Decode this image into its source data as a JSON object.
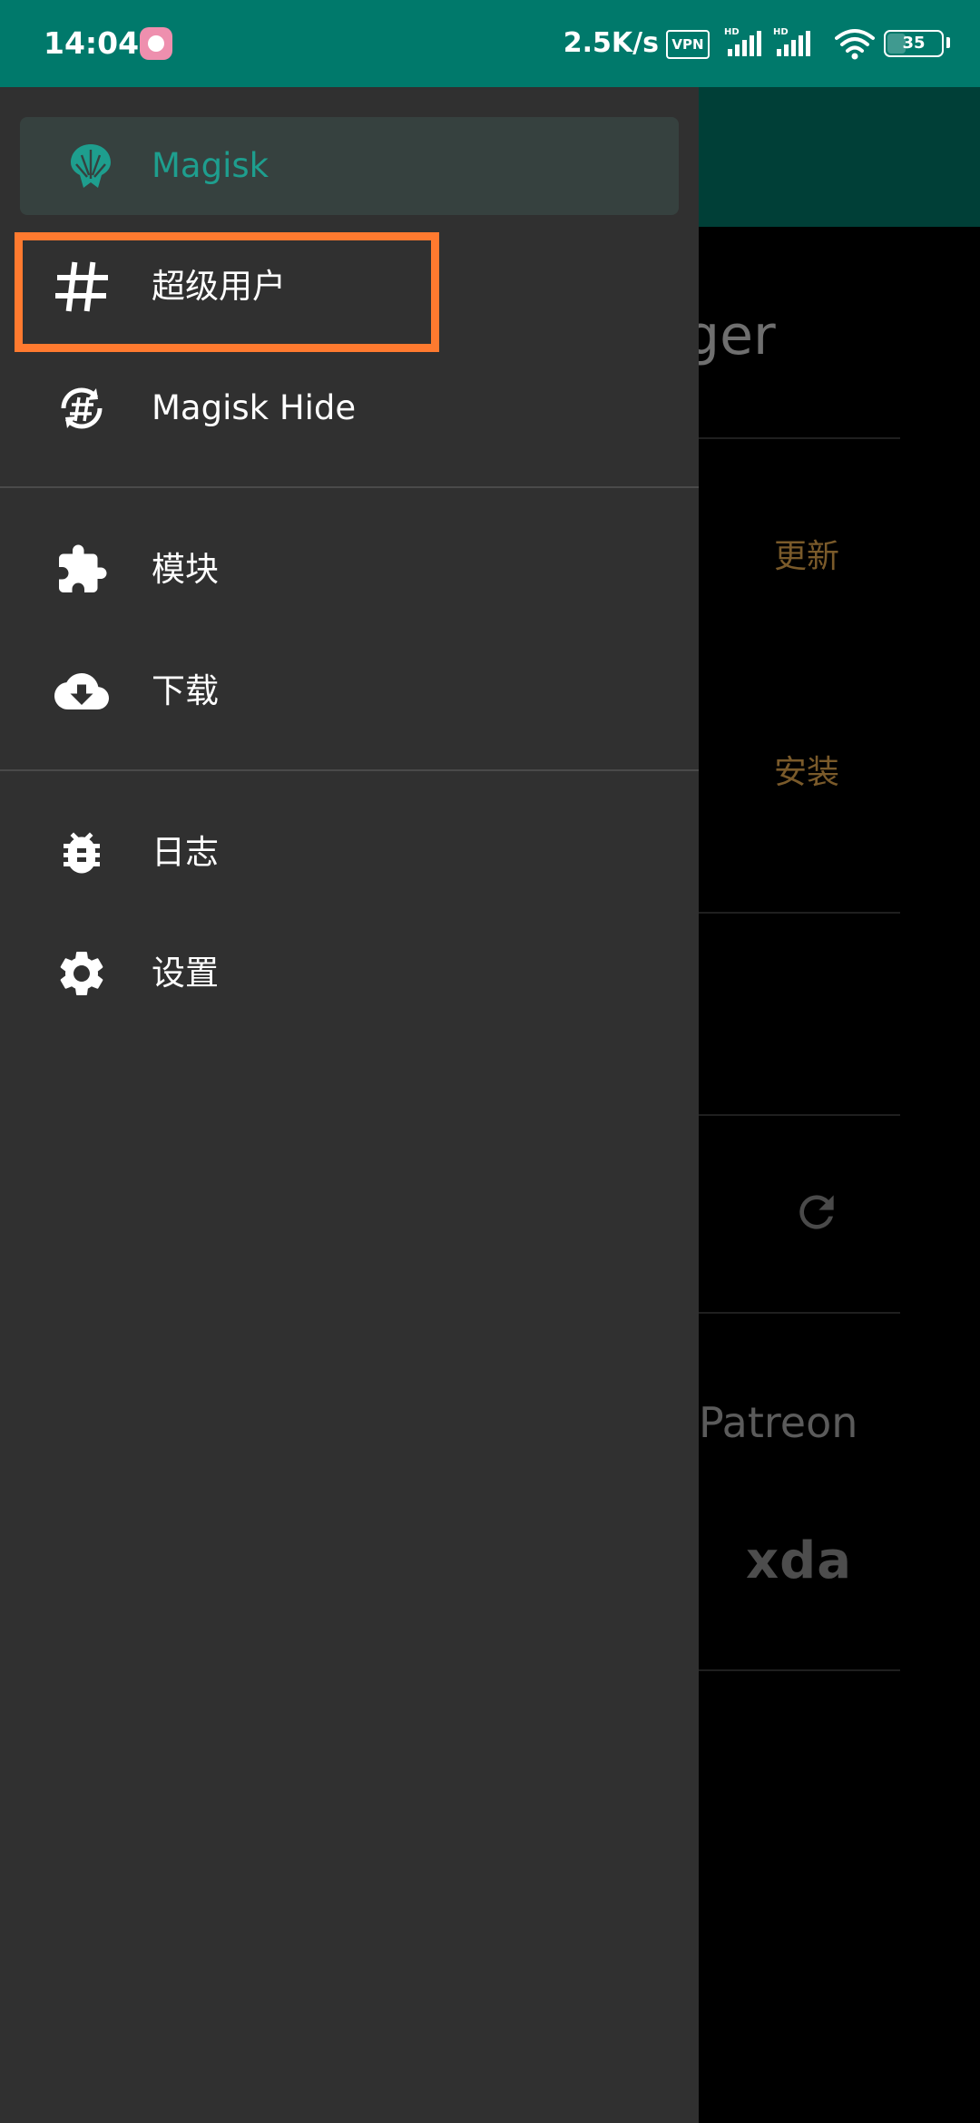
{
  "status_bar": {
    "time": "14:04",
    "net_speed": "2.5K/s",
    "vpn_label": "VPN",
    "battery_level": "35",
    "battery_fraction": 0.35,
    "icons": [
      "app-notification-icon",
      "vpn-icon",
      "hd-signal-icon",
      "hd-signal-icon",
      "wifi-icon",
      "battery-icon"
    ]
  },
  "drawer": {
    "header": {
      "label": "Magisk",
      "icon": "magisk-logo-icon",
      "color": "#1e9e8e"
    },
    "items": [
      {
        "label": "超级用户",
        "icon": "hash-icon"
      },
      {
        "label": "Magisk Hide",
        "icon": "magisk-hide-icon"
      },
      {
        "label": "模块",
        "icon": "puzzle-icon"
      },
      {
        "label": "下载",
        "icon": "cloud-download-icon"
      },
      {
        "label": "日志",
        "icon": "bug-icon"
      },
      {
        "label": "设置",
        "icon": "gear-icon"
      }
    ]
  },
  "background": {
    "title_fragment": "ger",
    "update_label": "更新",
    "install_label": "安装",
    "patreon_label": "Patreon",
    "xda_label": "xda",
    "accent": "#7a5a2a"
  },
  "highlight": {
    "color": "#ff7a2f"
  }
}
